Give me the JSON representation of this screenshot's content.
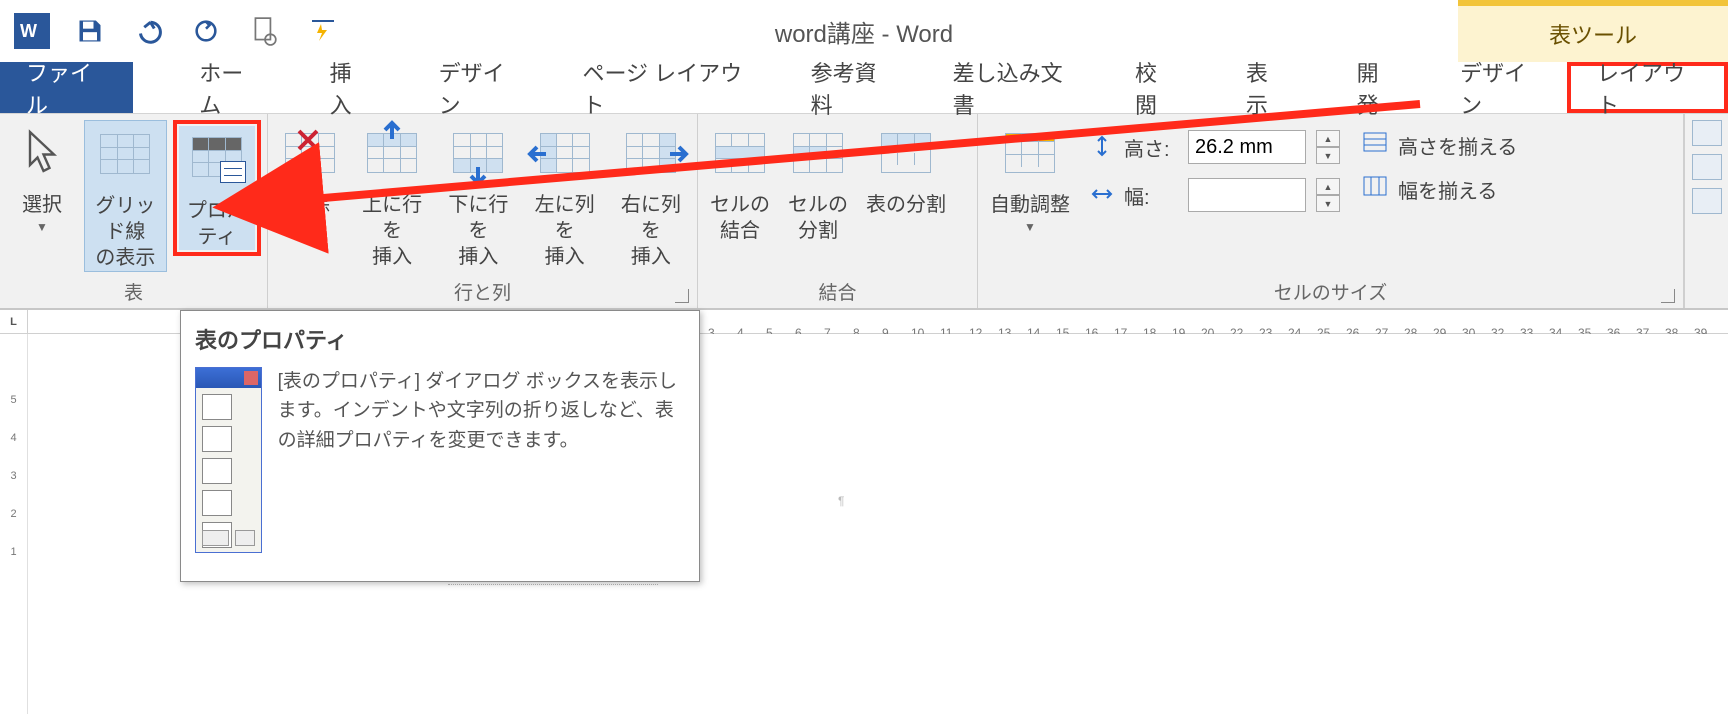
{
  "titlebar": {
    "title": "word講座 - Word",
    "context_tool": "表ツール"
  },
  "tabs": {
    "file": "ファイル",
    "items": [
      "ホーム",
      "挿入",
      "デザイン",
      "ページ レイアウト",
      "参考資料",
      "差し込み文書",
      "校閲",
      "表示",
      "開発",
      "デザイン",
      "レイアウト"
    ]
  },
  "ribbon": {
    "select": {
      "label": "選択"
    },
    "gridlines": {
      "label_l1": "グリッド線",
      "label_l2": "の表示"
    },
    "properties": {
      "label": "プロパティ"
    },
    "group_table": "表",
    "delete": {
      "label": "削除"
    },
    "insert_row_above": {
      "l1": "上に行を",
      "l2": "挿入"
    },
    "insert_row_below": {
      "l1": "下に行を",
      "l2": "挿入"
    },
    "insert_col_left": {
      "l1": "左に列を",
      "l2": "挿入"
    },
    "insert_col_right": {
      "l1": "右に列を",
      "l2": "挿入"
    },
    "group_rows_cols": "行と列",
    "merge_cells": {
      "l1": "セルの",
      "l2": "結合"
    },
    "split_cells": {
      "l1": "セルの",
      "l2": "分割"
    },
    "split_table": {
      "label": "表の分割"
    },
    "group_merge": "結合",
    "autofit": {
      "label": "自動調整"
    },
    "height_label": "高さ:",
    "height_value": "26.2 mm",
    "width_label": "幅:",
    "width_value": "",
    "dist_rows": "高さを揃える",
    "dist_cols": "幅を揃える",
    "group_cellsize": "セルのサイズ"
  },
  "tooltip": {
    "title": "表のプロパティ",
    "text": "[表のプロパティ] ダイアログ ボックスを表示します。インデントや文字列の折り返しなど、表の詳細プロパティを変更できます。"
  },
  "ruler": {
    "corner": "L",
    "h_ticks": [
      "3",
      "4",
      "5",
      "6",
      "7",
      "8",
      "9",
      "10",
      "11",
      "12",
      "13",
      "14",
      "15",
      "16",
      "17",
      "18",
      "19",
      "20",
      "22",
      "23",
      "24",
      "25",
      "26",
      "27",
      "28",
      "29",
      "30",
      "32",
      "33",
      "34",
      "35",
      "36",
      "37",
      "38",
      "39"
    ],
    "v_ticks": [
      "5",
      "4",
      "3",
      "2",
      "1"
    ]
  }
}
